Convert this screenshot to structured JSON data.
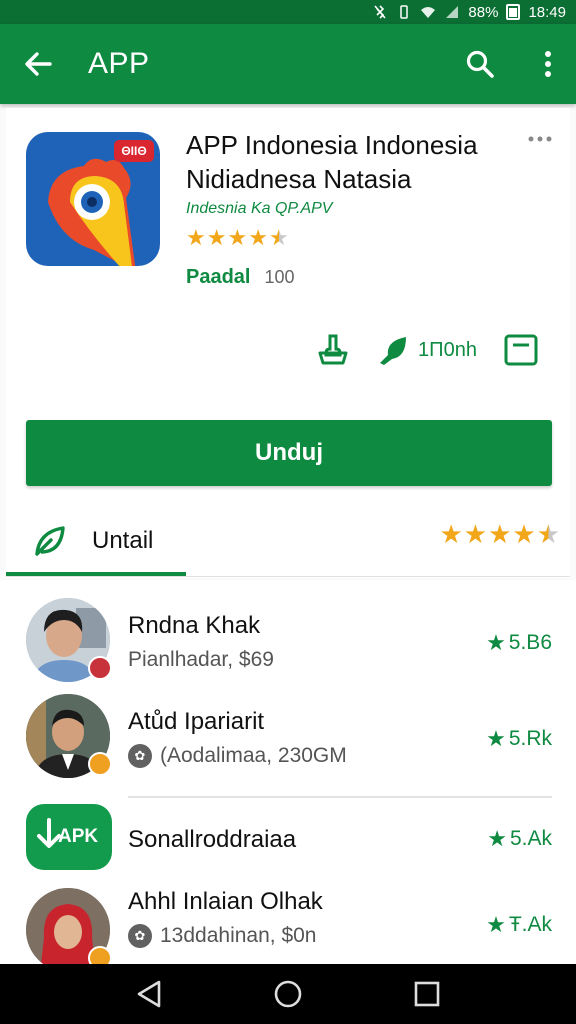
{
  "status_bar": {
    "battery": "88%",
    "time": "18:49"
  },
  "app_bar": {
    "title": "APP",
    "back_icon": "arrow-left-icon",
    "search_icon": "search-icon",
    "more_icon": "more-vert-icon"
  },
  "app": {
    "icon_badge": "ΘΙΙΘ",
    "title": "APP Indonesia Indonesia Nidiadnesa Natasia",
    "developer": "Indesnia Ka QP.APV",
    "rating_stars": 4.5,
    "price_label": "Paadal",
    "count": "100",
    "badges": [
      {
        "icon": "basket-icon",
        "label": ""
      },
      {
        "icon": "leaf-tag-icon",
        "label": "1Π0nh"
      },
      {
        "icon": "box-icon",
        "label": ""
      }
    ],
    "install_label": "Unduj"
  },
  "tab": {
    "label": "Untail",
    "icon": "leaf-icon",
    "rating_stars": 4.5
  },
  "list": [
    {
      "title": "Rndna Khak",
      "subtitle": "Pianlhadar, $69",
      "rating": "5.B6",
      "avatar": "person-avatar",
      "has_sub_icon": false
    },
    {
      "title": "Atůd Ipariarit",
      "subtitle": "(Aodalimaa, 230GM",
      "rating": "5.Rk",
      "avatar": "person-avatar",
      "has_sub_icon": true
    },
    {
      "title": "Sonallroddraiaa",
      "subtitle": "",
      "rating": "5.Ak",
      "avatar": "apk-logo",
      "avatar_text": "APK",
      "has_sub_icon": false
    },
    {
      "title": "Ahhl Inlaian Olhak",
      "subtitle": "13ddahinan, $0n",
      "rating": "Ŧ.Ak",
      "avatar": "person-avatar",
      "has_sub_icon": true
    }
  ],
  "colors": {
    "primary": "#0f8a41",
    "status_bar": "#0b6e33",
    "star": "#f2a71b",
    "icon_blue": "#1e63b8",
    "badge_red": "#d9262f"
  },
  "nav": {
    "back": "nav-back-icon",
    "home": "nav-home-icon",
    "recents": "nav-recents-icon"
  }
}
